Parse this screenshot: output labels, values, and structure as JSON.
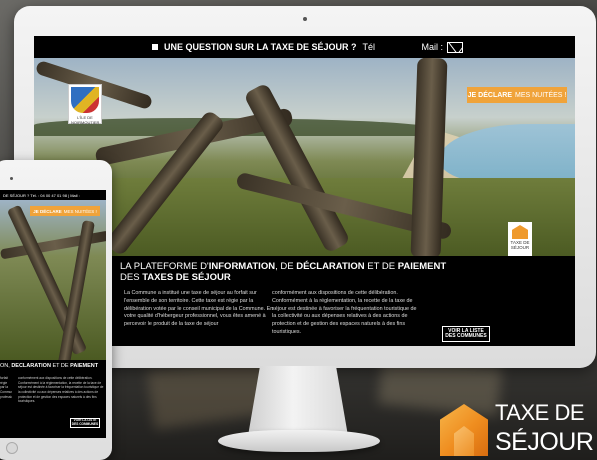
{
  "desktop": {
    "topbar": {
      "question": "UNE QUESTION SUR LA TAXE DE SÉJOUR ?",
      "tel_label": "Tél",
      "mail_label": "Mail :"
    },
    "hero": {
      "commune_logo_text": "L'ÎLE DE NOIRMOUTIER",
      "declare_strong": "JE DÉCLARE",
      "declare_light": "MES NUITÉES !",
      "badge_text": "TAXE DE SÉJOUR"
    },
    "info": {
      "headline_1": "LA PLATEFORME D'",
      "headline_info": "INFORMATION",
      "headline_2": ", DE ",
      "headline_decl": "DÉCLARATION",
      "headline_3": " ET DE ",
      "headline_pay": "PAIEMENT",
      "headline_4": "DES ",
      "headline_taxes": "TAXES DE SÉJOUR",
      "col1": "La Commune a institué une taxe de séjour au forfait sur l'ensemble de son territoire. Cette taxe est régie par la délibération votée par le conseil municipal de la Commune. En votre qualité d'hébergeur professionnel, vous êtes amené à percevoir le produit de la taxe de séjour",
      "col2": "conformément aux dispositions de cette délibération. Conformément à la réglementation, la recette de la taxe de séjour est destinée à favoriser la fréquentation touristique de la collectivité ou aux dépenses relatives à des actions de protection et de gestion des espaces naturels à des fins touristiques.",
      "liste_button": "VOIR LA LISTE DES COMMUNES"
    }
  },
  "tablet": {
    "topbar": "DE SÉJOUR ?  Tél. : 04 00 47 01 98  |  Mail :",
    "declare_strong": "JE DÉCLARE",
    "declare_light": "MES NUITÉES !",
    "headline_1": "ON, ",
    "headline_decl": "DÉCLARATION",
    "headline_2": " ET DE ",
    "headline_pay": "PAIEMENT",
    "col1": "forfait régie par la Commune professionnel",
    "col2": "conformément aux dispositions de cette délibération. Conformément à la réglementation, la recette de la taxe de séjour est destinée à favoriser la fréquentation touristique de la collectivité ou aux dépenses relatives à des actions de protection et de gestion des espaces naturels à des fins touristiques.",
    "liste_button": "VOIR LA LISTE DES COMMUNES"
  },
  "brand": {
    "line1": "TAXE DE",
    "line2": "SÉJOUR",
    "accent_color": "#ef9a2d"
  }
}
